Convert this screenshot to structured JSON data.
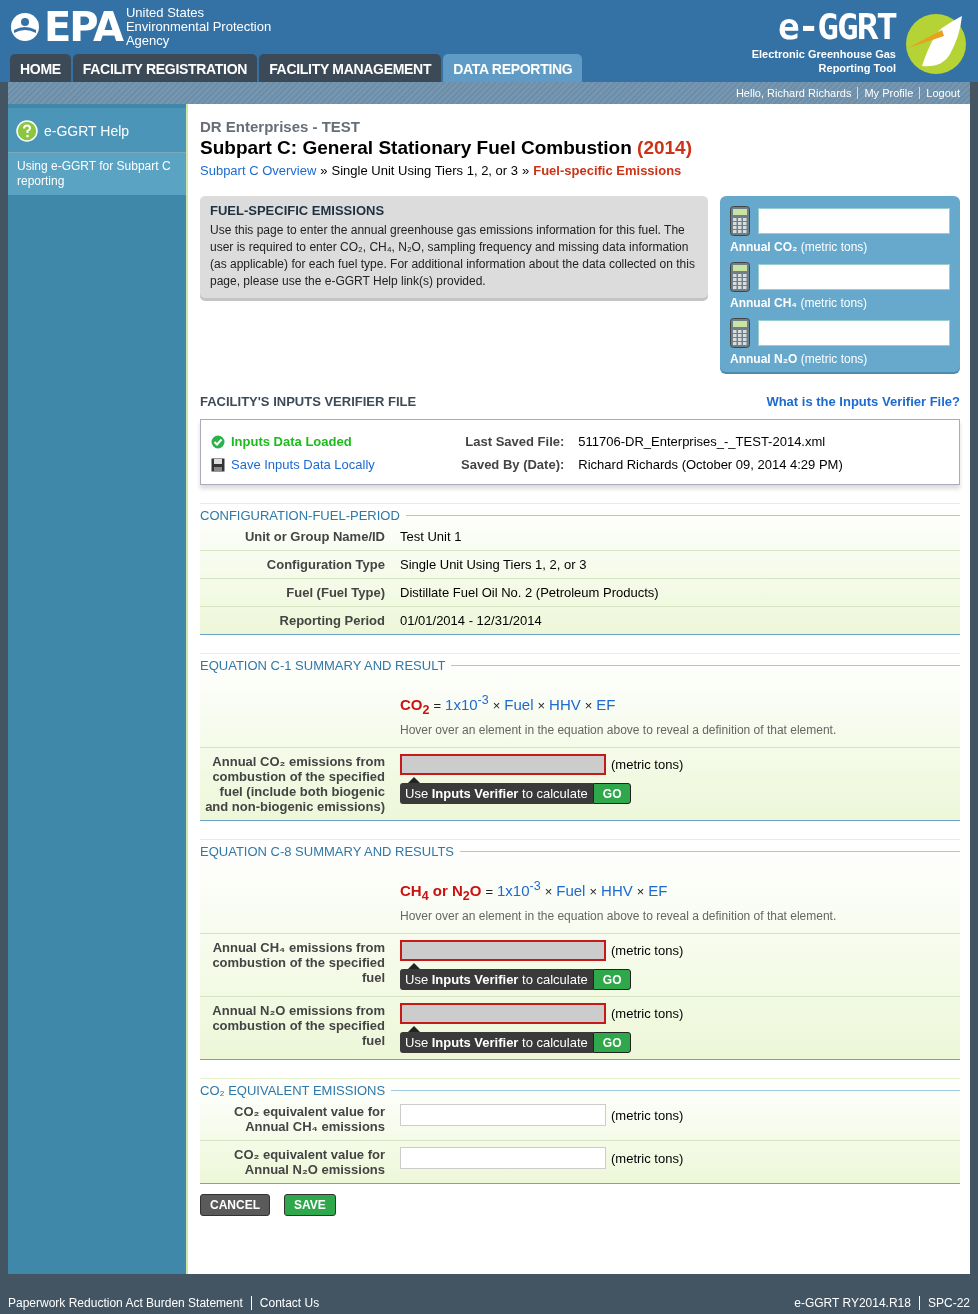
{
  "header": {
    "agency_lines": [
      "United States",
      "Environmental Protection",
      "Agency"
    ],
    "logo_text": "EPA",
    "app_logo": "e-GGRT",
    "app_name_lines": [
      "Electronic Greenhouse Gas",
      "Reporting Tool"
    ]
  },
  "nav_tabs": [
    {
      "label": "HOME",
      "selected": false
    },
    {
      "label": "FACILITY REGISTRATION",
      "selected": false
    },
    {
      "label": "FACILITY MANAGEMENT",
      "selected": false
    },
    {
      "label": "DATA REPORTING",
      "selected": true
    }
  ],
  "user_links": [
    "Hello, Richard Richards",
    "My Profile",
    "Logout"
  ],
  "sidebar": {
    "help_title": "e-GGRT Help",
    "items": [
      "Using e-GGRT for Subpart C reporting"
    ]
  },
  "page": {
    "company": "DR Enterprises - TEST",
    "title": "Subpart C: General Stationary Fuel Combustion",
    "year": "(2014)",
    "breadcrumb": [
      {
        "label": "Subpart C Overview",
        "kind": "link"
      },
      {
        "label": "»",
        "kind": "separator"
      },
      {
        "label": "Single Unit Using Tiers 1, 2, or 3",
        "kind": "text"
      },
      {
        "label": "»",
        "kind": "separator"
      },
      {
        "label": "Fuel-specific Emissions",
        "kind": "current"
      }
    ]
  },
  "intro": {
    "title": "FUEL-SPECIFIC EMISSIONS",
    "text": "Use this page to enter the annual greenhouse gas emissions information for this fuel. The user is required to enter CO₂, CH₄, N₂O, sampling frequency and missing data information (as applicable) for each fuel type. For additional information about the data collected on this page, please use the e-GGRT Help link(s) provided."
  },
  "totals": [
    {
      "label": "Annual CO₂",
      "unit": "(metric tons)"
    },
    {
      "label": "Annual CH₄",
      "unit": "(metric tons)"
    },
    {
      "label": "Annual N₂O",
      "unit": "(metric tons)"
    }
  ],
  "verifier": {
    "title": "FACILITY'S INPUTS VERIFIER FILE",
    "help_link": "What is the Inputs Verifier File?",
    "status": "Inputs Data Loaded",
    "save_link": "Save Inputs Data Locally",
    "details": [
      {
        "label": "Last Saved File:",
        "value": "511706-DR_Enterprises_-_TEST-2014.xml"
      },
      {
        "label": "Saved By (Date):",
        "value": "Richard Richards (October 09, 2014 4:29 PM)"
      }
    ]
  },
  "sections": [
    {
      "title": "CONFIGURATION-FUEL-PERIOD",
      "rows": [
        {
          "kind": "value",
          "label": "Unit or Group Name/ID",
          "value": "Test Unit 1"
        },
        {
          "kind": "value",
          "label": "Configuration Type",
          "value": "Single Unit Using Tiers 1, 2, or 3"
        },
        {
          "kind": "value",
          "label": "Fuel (Fuel Type)",
          "value": "Distillate Fuel Oil No. 2 (Petroleum Products)"
        },
        {
          "kind": "value",
          "label": "Reporting Period",
          "value": "01/01/2014 - 12/31/2014"
        }
      ]
    },
    {
      "title": "EQUATION C-1 SUMMARY AND RESULT",
      "equation": [
        {
          "kind": "result",
          "text": "CO$_{2}$"
        },
        {
          "kind": "operator",
          "text": "="
        },
        {
          "kind": "factor",
          "text": "1x10$^{-3}$"
        },
        {
          "kind": "operator",
          "text": "×"
        },
        {
          "kind": "term",
          "text": "Fuel"
        },
        {
          "kind": "operator",
          "text": "×"
        },
        {
          "kind": "term",
          "text": "HHV"
        },
        {
          "kind": "operator",
          "text": "×"
        },
        {
          "kind": "term",
          "text": "EF"
        }
      ],
      "hint": "Hover over an element in the equation above to reveal a definition of that element.",
      "rows": [
        {
          "kind": "calculated",
          "label": "Annual CO₂ emissions from combustion of the specified fuel (include both biogenic and non-biogenic emissions)",
          "unit": "(metric tons)",
          "tool": "Use **Inputs Verifier** to calculate",
          "go": "GO"
        }
      ]
    },
    {
      "title": "EQUATION C-8 SUMMARY AND RESULTS",
      "equation": [
        {
          "kind": "result",
          "text": "CH$_{4}$ or N$_{2}$O"
        },
        {
          "kind": "operator",
          "text": "="
        },
        {
          "kind": "factor",
          "text": "1x10$^{-3}$"
        },
        {
          "kind": "operator",
          "text": "×"
        },
        {
          "kind": "term",
          "text": "Fuel"
        },
        {
          "kind": "operator",
          "text": "×"
        },
        {
          "kind": "term",
          "text": "HHV"
        },
        {
          "kind": "operator",
          "text": "×"
        },
        {
          "kind": "term",
          "text": "EF"
        }
      ],
      "hint": "Hover over an element in the equation above to reveal a definition of that element.",
      "rows": [
        {
          "kind": "calculated",
          "label": "Annual CH₄ emissions from combustion of the specified fuel",
          "unit": "(metric tons)",
          "tool": "Use **Inputs Verifier** to calculate",
          "go": "GO"
        },
        {
          "kind": "calculated",
          "label": "Annual N₂O emissions from combustion of the specified fuel",
          "unit": "(metric tons)",
          "tool": "Use **Inputs Verifier** to calculate",
          "go": "GO"
        }
      ]
    },
    {
      "title": "CO₂ EQUIVALENT EMISSIONS",
      "rows": [
        {
          "kind": "input",
          "label": "CO₂ equivalent value for Annual CH₄ emissions",
          "unit": "(metric tons)"
        },
        {
          "kind": "input",
          "label": "CO₂ equivalent value for Annual N₂O emissions",
          "unit": "(metric tons)"
        }
      ]
    }
  ],
  "actions": [
    {
      "label": "CANCEL",
      "kind": "secondary"
    },
    {
      "label": "SAVE",
      "kind": "primary"
    }
  ],
  "footer": {
    "left": [
      "Paperwork Reduction Act Burden Statement",
      "Contact Us"
    ],
    "right": [
      "e-GGRT RY2014.R18",
      "SPC-22"
    ]
  }
}
